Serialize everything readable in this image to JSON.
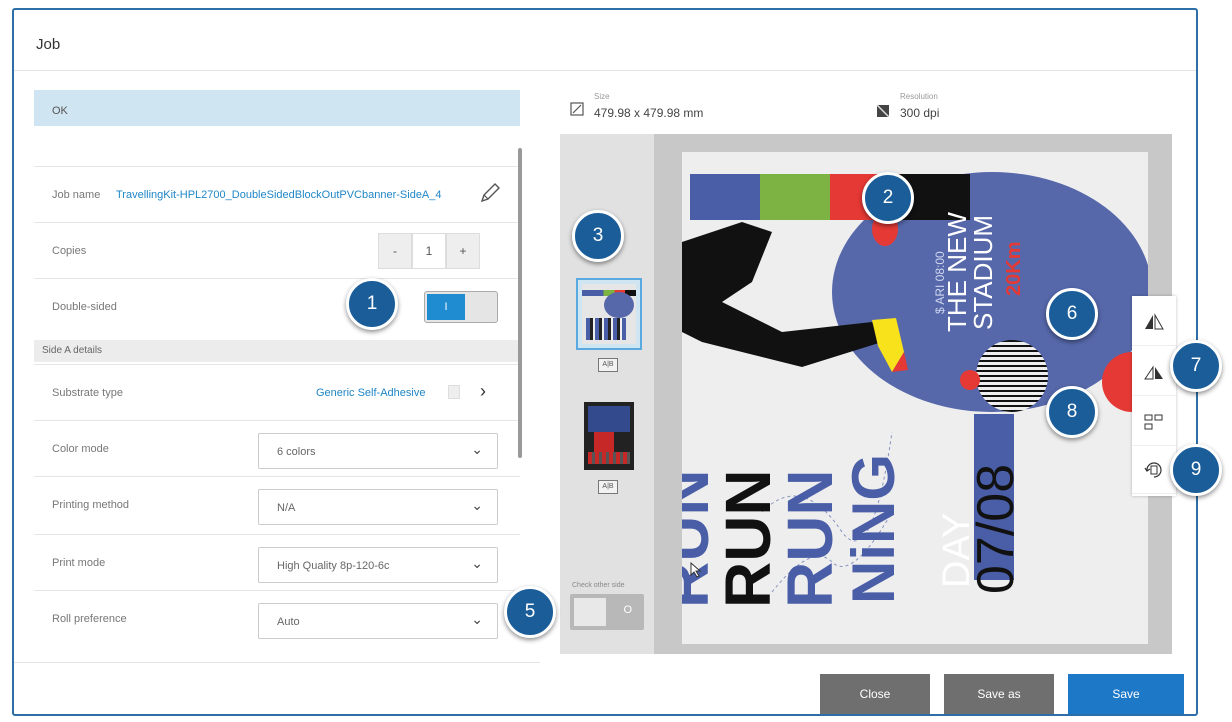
{
  "dialog": {
    "title": "Job"
  },
  "status": {
    "text": "OK"
  },
  "job_name": {
    "label": "Job name",
    "value": "TravellingKit-HPL2700_DoubleSidedBlockOutPVCbanner-SideA_4"
  },
  "copies": {
    "label": "Copies",
    "minus": "-",
    "value": "1",
    "plus": "+"
  },
  "double_sided": {
    "label": "Double-sided",
    "state_label": "I",
    "enabled": true
  },
  "side_a": {
    "section_label": "Side A details"
  },
  "substrate": {
    "label": "Substrate type",
    "value": "Generic Self-Adhesive",
    "chevron": "›"
  },
  "color_mode": {
    "label": "Color mode",
    "value": "6 colors"
  },
  "printing_method": {
    "label": "Printing method",
    "value": "N/A"
  },
  "print_mode": {
    "label": "Print mode",
    "value": "High Quality 8p-120-6c"
  },
  "roll_preference": {
    "label": "Roll preference",
    "value": "Auto"
  },
  "info": {
    "size_caption": "Size",
    "size_value": "479.98 x 479.98 mm",
    "resolution_caption": "Resolution",
    "resolution_value": "300 dpi"
  },
  "thumbs": {
    "ab_label": "A|B"
  },
  "check_other_side": {
    "caption": "Check other side",
    "state_label": "O",
    "enabled": false
  },
  "poster": {
    "event_line": "$ ARI 08:00",
    "venue_1": "THE NEW",
    "venue_2": "STADIUM",
    "distance": "20Km",
    "word_1": "RUN",
    "word_2": "RUN",
    "word_3": "RUN",
    "word_4": "NiNG",
    "day": "DAY",
    "date": "07/08",
    "bar_colors": [
      "#4a5ea8",
      "#7cb342",
      "#e53935",
      "#111111"
    ]
  },
  "callouts": [
    "1",
    "2",
    "3",
    "5",
    "6",
    "7",
    "8",
    "9"
  ],
  "footer": {
    "close_label": "Close",
    "save_as_label": "Save as",
    "save_label": "Save"
  },
  "colors": {
    "accent": "#1f8bd0",
    "callout": "#1a5d99",
    "button_gray": "#6f6f6f",
    "save_blue": "#1e78c8"
  },
  "icons": [
    "size-icon",
    "resolution-icon",
    "pencil-icon",
    "flip-horizontal-icon",
    "flip-vertical-icon",
    "align-icon",
    "rotate-icon"
  ]
}
